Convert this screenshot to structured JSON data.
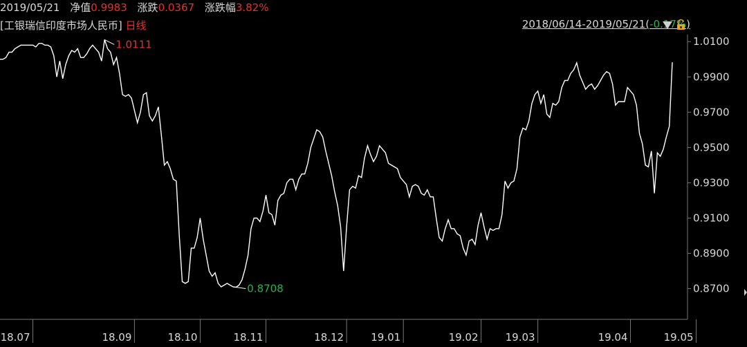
{
  "header": {
    "date": "2019/05/21",
    "nav_label": "净值",
    "nav_value": "0.9983",
    "change_label": "涨跌",
    "change_value": "0.0367",
    "pct_label": "涨跌幅",
    "pct_value": "3.82%",
    "fund_name": "[工银瑞信印度市场人民币]",
    "period": "日线",
    "range_prefix": "2018/06/14-2019/05/21(",
    "range_change": "-0.17%",
    "range_suffix": ")"
  },
  "colors": {
    "up": "#e8302a",
    "down": "#2ab14a",
    "line": "#ffffff",
    "bg": "#000000"
  },
  "icons": [
    "dropdown-triangle-icon",
    "lock-icon",
    "scroll-right-icon"
  ],
  "chart_data": {
    "type": "line",
    "title": "",
    "xlabel": "",
    "ylabel": "",
    "ylim": [
      0.862,
      1.014
    ],
    "yticks": [
      "1.0100",
      "0.9900",
      "0.9700",
      "0.9500",
      "0.9300",
      "0.9100",
      "0.8900",
      "0.8700"
    ],
    "xtick_labels": [
      "18.07",
      "18.09",
      "18.10",
      "18.11",
      "18.12",
      "19.01",
      "19.02",
      "19.03",
      "19.04",
      "19.05"
    ],
    "xtick_index": [
      11,
      45,
      67,
      89,
      116,
      135,
      161,
      180,
      211,
      233
    ],
    "max_label": "1.0111",
    "max_index": 35,
    "min_label": "0.8708",
    "min_index": 79,
    "series": [
      {
        "name": "",
        "values": [
          1.0,
          1.0,
          1.001,
          1.004,
          1.004,
          1.006,
          1.007,
          1.008,
          1.008,
          1.008,
          1.008,
          1.008,
          1.007,
          1.009,
          1.009,
          1.008,
          1.008,
          1.007,
          1.002,
          0.99,
          0.999,
          0.989,
          0.997,
          1.002,
          1.005,
          1.004,
          1.006,
          1.001,
          1.001,
          1.003,
          1.006,
          1.008,
          1.006,
          1.004,
          0.999,
          1.0111,
          1.006,
          1.004,
          0.997,
          1.001,
          0.992,
          0.98,
          0.979,
          0.98,
          0.978,
          0.971,
          0.964,
          0.97,
          0.98,
          0.981,
          0.968,
          0.965,
          0.968,
          0.973,
          0.957,
          0.94,
          0.942,
          0.938,
          0.932,
          0.931,
          0.9,
          0.874,
          0.873,
          0.874,
          0.893,
          0.893,
          0.899,
          0.91,
          0.898,
          0.889,
          0.88,
          0.877,
          0.879,
          0.873,
          0.871,
          0.872,
          0.873,
          0.872,
          0.871,
          0.8708,
          0.872,
          0.875,
          0.881,
          0.889,
          0.904,
          0.91,
          0.91,
          0.908,
          0.914,
          0.923,
          0.913,
          0.912,
          0.906,
          0.92,
          0.923,
          0.924,
          0.93,
          0.932,
          0.932,
          0.926,
          0.932,
          0.935,
          0.935,
          0.941,
          0.95,
          0.955,
          0.96,
          0.959,
          0.956,
          0.948,
          0.941,
          0.934,
          0.925,
          0.917,
          0.905,
          0.88,
          0.905,
          0.926,
          0.928,
          0.927,
          0.934,
          0.933,
          0.944,
          0.951,
          0.946,
          0.942,
          0.945,
          0.951,
          0.949,
          0.947,
          0.941,
          0.94,
          0.939,
          0.938,
          0.933,
          0.931,
          0.929,
          0.922,
          0.928,
          0.929,
          0.928,
          0.924,
          0.923,
          0.926,
          0.922,
          0.922,
          0.91,
          0.899,
          0.897,
          0.904,
          0.909,
          0.904,
          0.904,
          0.901,
          0.9,
          0.893,
          0.889,
          0.897,
          0.898,
          0.895,
          0.906,
          0.913,
          0.905,
          0.898,
          0.904,
          0.903,
          0.904,
          0.904,
          0.912,
          0.931,
          0.927,
          0.93,
          0.931,
          0.938,
          0.956,
          0.961,
          0.96,
          0.965,
          0.975,
          0.98,
          0.982,
          0.975,
          0.98,
          0.969,
          0.967,
          0.975,
          0.974,
          0.976,
          0.984,
          0.988,
          0.988,
          0.992,
          0.994,
          0.998,
          0.991,
          0.987,
          0.983,
          0.985,
          0.986,
          0.983,
          0.985,
          0.988,
          0.991,
          0.993,
          0.992,
          0.986,
          0.974,
          0.976,
          0.976,
          0.976,
          0.984,
          0.982,
          0.98,
          0.974,
          0.958,
          0.952,
          0.94,
          0.939,
          0.948,
          0.924,
          0.947,
          0.945,
          0.949,
          0.956,
          0.962,
          0.9983
        ]
      }
    ]
  }
}
